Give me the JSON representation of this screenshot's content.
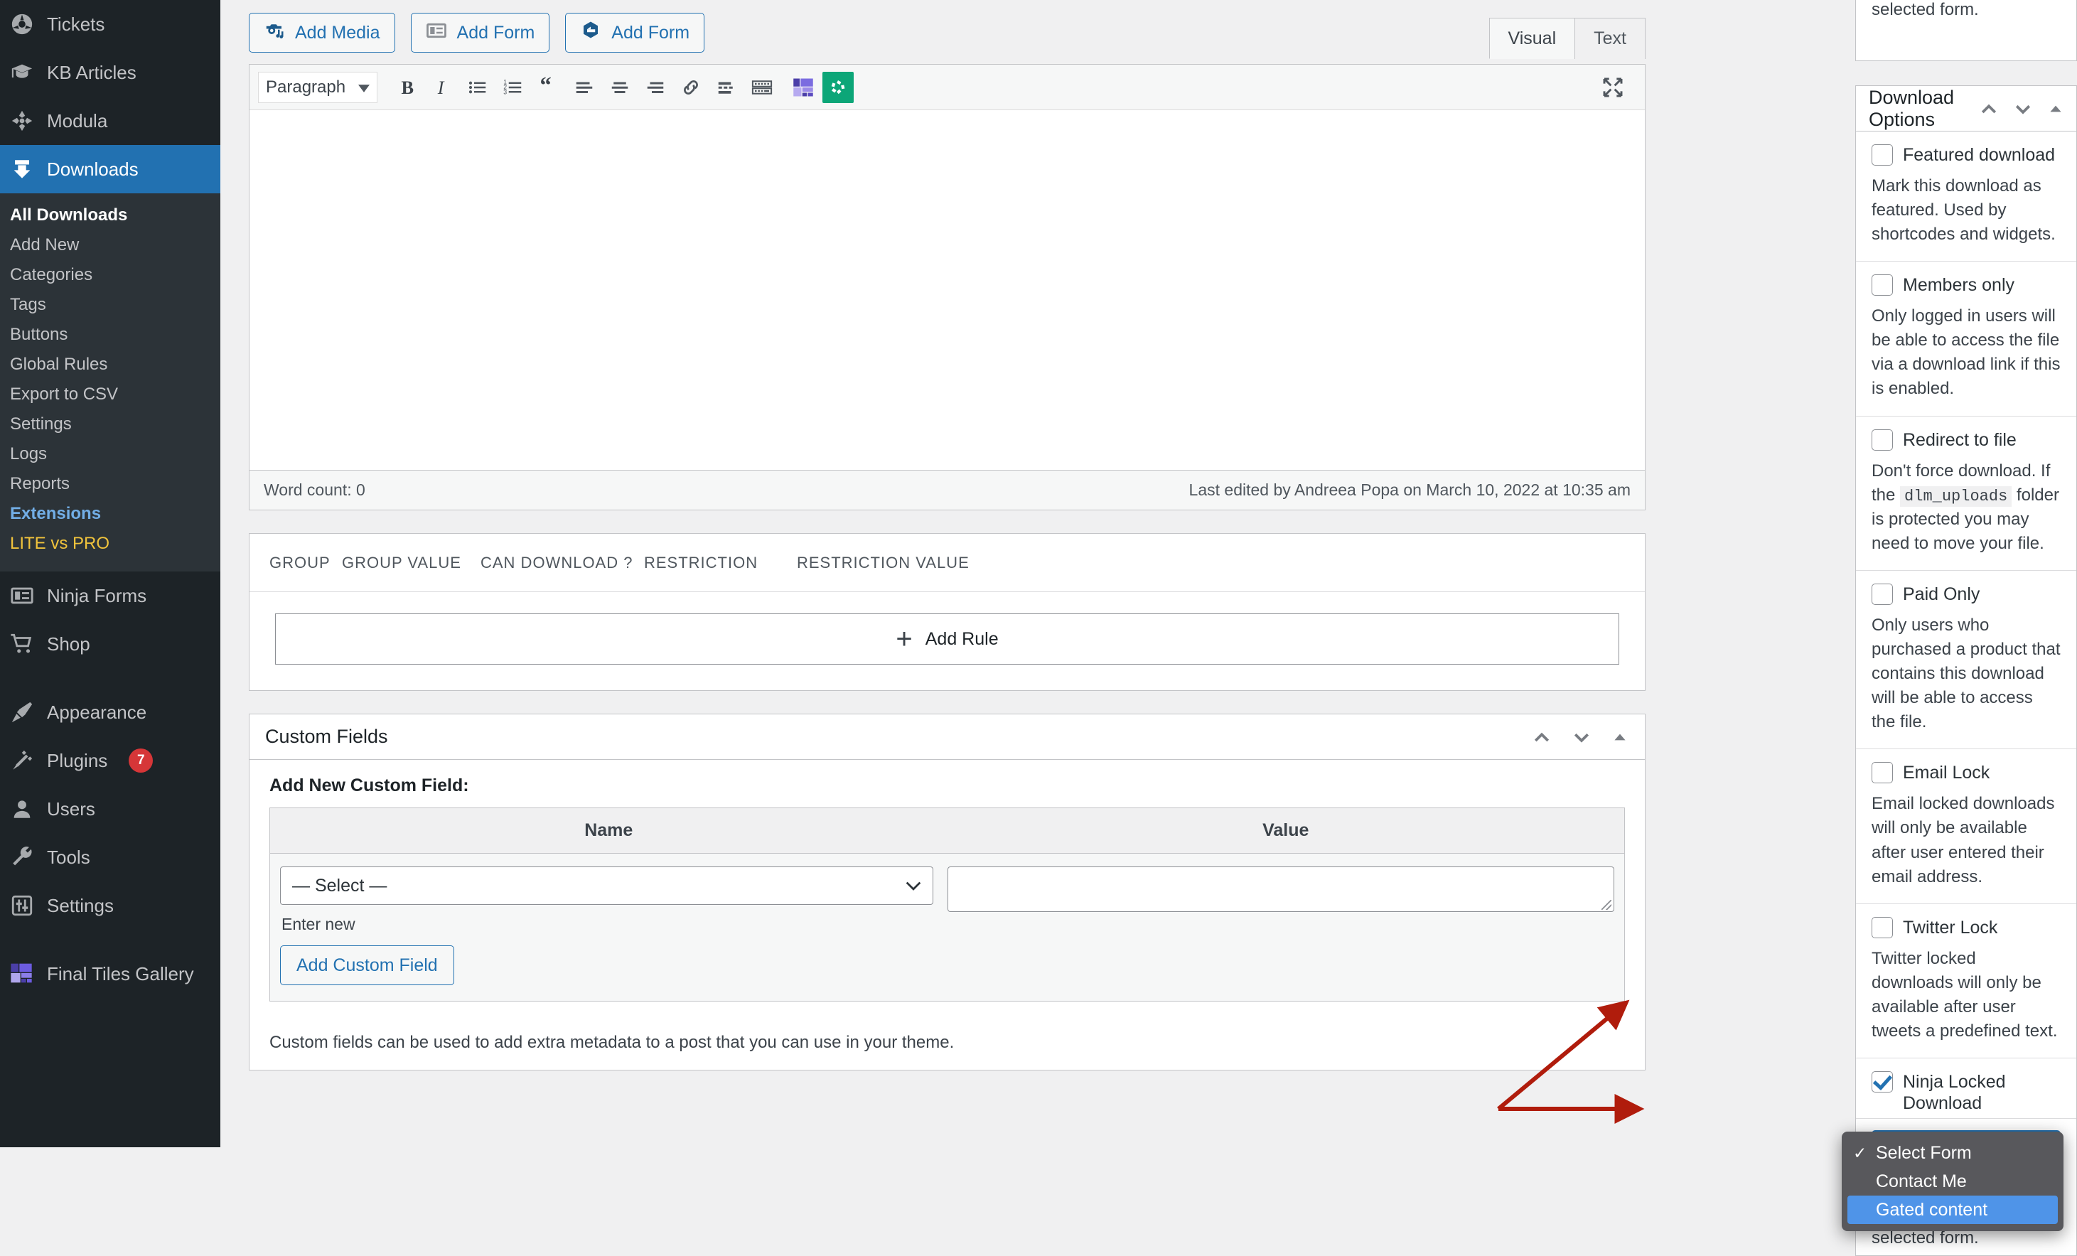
{
  "sidebar": {
    "top_items": [
      {
        "label": "Tickets",
        "icon": "ticket-icon"
      },
      {
        "label": "KB Articles",
        "icon": "graduation-cap-icon"
      },
      {
        "label": "Modula",
        "icon": "modula-icon"
      }
    ],
    "current_item": {
      "label": "Downloads",
      "icon": "download-icon"
    },
    "submenu": [
      {
        "label": "All Downloads",
        "state": "current"
      },
      {
        "label": "Add New",
        "state": "normal"
      },
      {
        "label": "Categories",
        "state": "normal"
      },
      {
        "label": "Tags",
        "state": "normal"
      },
      {
        "label": "Buttons",
        "state": "normal"
      },
      {
        "label": "Global Rules",
        "state": "normal"
      },
      {
        "label": "Export to CSV",
        "state": "normal"
      },
      {
        "label": "Settings",
        "state": "normal"
      },
      {
        "label": "Logs",
        "state": "normal"
      },
      {
        "label": "Reports",
        "state": "normal"
      },
      {
        "label": "Extensions",
        "state": "blue"
      },
      {
        "label": "LITE vs PRO",
        "state": "yellow"
      }
    ],
    "bottom_items": [
      {
        "label": "Ninja Forms",
        "icon": "forms-icon",
        "badge": ""
      },
      {
        "label": "Shop",
        "icon": "cart-icon",
        "badge": ""
      },
      {
        "label": "Appearance",
        "icon": "paintbrush-icon",
        "badge": ""
      },
      {
        "label": "Plugins",
        "icon": "plug-icon",
        "badge": "7"
      },
      {
        "label": "Users",
        "icon": "user-icon",
        "badge": ""
      },
      {
        "label": "Tools",
        "icon": "wrench-icon",
        "badge": ""
      },
      {
        "label": "Settings",
        "icon": "sliders-icon",
        "badge": ""
      },
      {
        "label": "Final Tiles Gallery",
        "icon": "tiles-icon",
        "badge": ""
      }
    ]
  },
  "editor": {
    "media_buttons": [
      {
        "label": "Add Media",
        "icon": "media-camera-note-icon"
      },
      {
        "label": "Add Form",
        "icon": "form-list-icon"
      },
      {
        "label": "Add Form",
        "icon": "ninja-hex-icon"
      }
    ],
    "tabs": [
      {
        "label": "Visual",
        "active": true
      },
      {
        "label": "Text",
        "active": false
      }
    ],
    "format_select": "Paragraph",
    "toolbar_icons": [
      "bold-icon",
      "italic-icon",
      "bulleted-list-icon",
      "numbered-list-icon",
      "blockquote-icon",
      "align-left-icon",
      "align-center-icon",
      "align-right-icon",
      "link-icon",
      "read-more-icon",
      "toolbar-toggle-icon",
      "final-tiles-gallery-icon",
      "ninja-forms-green-icon"
    ],
    "fullscreen_icon": "fullscreen-icon",
    "word_count": "Word count: 0",
    "last_edited": "Last edited by Andreea Popa on March 10, 2022 at 10:35 am"
  },
  "rules": {
    "columns": [
      "GROUP",
      "GROUP VALUE",
      "CAN DOWNLOAD ?",
      "RESTRICTION",
      "RESTRICTION VALUE"
    ],
    "add_rule_label": "Add Rule",
    "add_rule_icon": "plus-icon"
  },
  "custom_fields": {
    "title": "Custom Fields",
    "handle_icons": [
      "move-up-icon",
      "move-down-icon",
      "toggle-panel-icon"
    ],
    "add_new_label": "Add New Custom Field:",
    "columns": {
      "name": "Name",
      "value": "Value"
    },
    "name_select_value": "— Select —",
    "enter_new_label": "Enter new",
    "value_textarea": "",
    "add_button_label": "Add Custom Field",
    "help_text": "Custom fields can be used to add extra metadata to a post that you can use in your theme."
  },
  "side": {
    "top_panel_tail": "selected form.",
    "download_options": {
      "title": "Download Options",
      "handle_icons": [
        "move-up-icon",
        "move-down-icon",
        "toggle-panel-icon"
      ],
      "options": [
        {
          "label": "Featured download",
          "checked": false,
          "desc": "Mark this download as featured. Used by shortcodes and widgets."
        },
        {
          "label": "Members only",
          "checked": false,
          "desc": "Only logged in users will be able to access the file via a download link if this is enabled."
        },
        {
          "label": "Redirect to file",
          "checked": false,
          "desc_before": "Don't force download. If the",
          "code": "dlm_uploads",
          "desc_after": "folder is protected you may need to move your file."
        },
        {
          "label": "Paid Only",
          "checked": false,
          "desc": "Only users who purchased a product that contains this download will be able to access the file."
        },
        {
          "label": "Email Lock",
          "checked": false,
          "desc": "Email locked downloads will only be available after user entered their email address."
        },
        {
          "label": "Twitter Lock",
          "checked": false,
          "desc": "Twitter locked downloads will only be available after user tweets a predefined text."
        },
        {
          "label": "Ninja Locked Download",
          "checked": true,
          "desc": ""
        }
      ]
    },
    "form_dropdown": {
      "options": [
        {
          "label": "Select Form",
          "selected": false,
          "checked": true
        },
        {
          "label": "Contact Me",
          "selected": false,
          "checked": false
        },
        {
          "label": "Gated content",
          "selected": true,
          "checked": false
        }
      ],
      "tail_text": "selected form."
    }
  },
  "annotation": {
    "arrow_color": "#b01c0c",
    "arrows": 2
  }
}
